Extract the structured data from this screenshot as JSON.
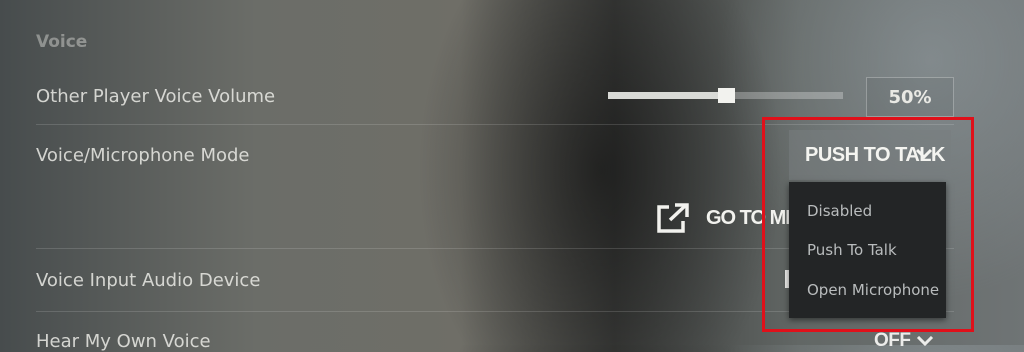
{
  "section": {
    "title": "Voice"
  },
  "rows": {
    "other_volume": {
      "label": "Other Player Voice Volume",
      "value": "50%",
      "level": 0.5
    },
    "mic_mode": {
      "label": "Voice/Microphone Mode",
      "selected": "PUSH TO TALK"
    },
    "go_to_mic": {
      "label": "GO TO MICROPHONE"
    },
    "input_device": {
      "label": "Voice Input Audio Device"
    },
    "hear_own": {
      "label": "Hear My Own Voice",
      "value": "OFF"
    }
  },
  "dropdown_menu": {
    "options": [
      "Disabled",
      "Push To Talk",
      "Open Microphone"
    ]
  },
  "icons": {
    "dropdown": "chevron-down-icon",
    "external": "external-link-icon"
  },
  "colors": {
    "highlight": "#e0101a",
    "menu_bg": "#232526"
  }
}
